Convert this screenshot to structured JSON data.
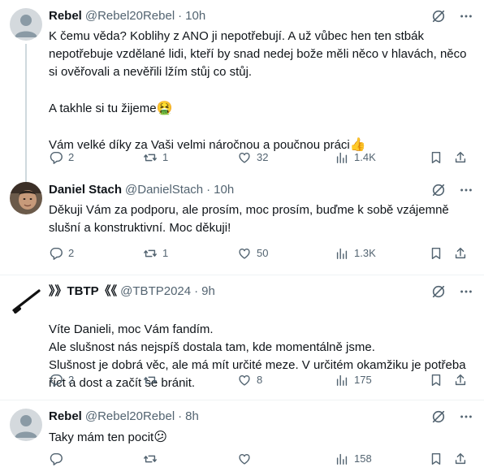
{
  "tweets": [
    {
      "name": "Rebel",
      "handle": "@Rebel20Rebel",
      "time": "10h",
      "paragraphs": [
        "K čemu věda? Koblihy z ANO ji nepotřebují. A už vůbec hen ten stbák nepotřebuje vzdělané lidi, kteří by snad nedej bože měli něco v hlavách, něco si ověřovali a nevěřili lžím stůj co stůj.",
        "A takhle si tu žijeme",
        "Vám velké díky za Vaši velmi náročnou a poučnou práci"
      ],
      "emojis": [
        "🤮",
        "👍"
      ],
      "replies": "2",
      "reposts": "1",
      "likes": "32",
      "views": "1.4K"
    },
    {
      "name": "Daniel Stach",
      "handle": "@DanielStach",
      "time": "10h",
      "paragraphs": [
        "Děkuji Vám za podporu, ale prosím, moc prosím, buďme k sobě vzájemně slušní a konstruktivní. Moc děkuji!"
      ],
      "replies": "2",
      "reposts": "1",
      "likes": "50",
      "views": "1.3K"
    },
    {
      "name": "》》TBTP《《",
      "handle": "@TBTP2024",
      "time": "9h",
      "paragraphs": [
        "Víte Danieli, moc Vám fandím.\nAle slušnost nás nejspíš dostala tam, kde momentálně jsme.\nSlušnost je dobrá věc, ale má mít určité meze. V určitém okamžiku je potřeba říct a dost a začít se bránit."
      ],
      "replies": "2",
      "reposts": "",
      "likes": "8",
      "views": "175"
    },
    {
      "name": "Rebel",
      "handle": "@Rebel20Rebel",
      "time": "8h",
      "paragraphs": [
        "Taky mám ten pocit"
      ],
      "emojis": [
        "😕"
      ],
      "replies": "",
      "reposts": "",
      "likes": "",
      "views": "158"
    }
  ],
  "separator": "·",
  "colors": {
    "text": "#0f1419",
    "secondary": "#536471",
    "thread_line": "#cfd9de",
    "divider": "#eff3f4",
    "grok_icon": "#536471"
  },
  "icons": [
    "default-avatar-icon",
    "grok-icon",
    "more-icon",
    "reply-icon",
    "repost-icon",
    "like-icon",
    "views-icon",
    "bookmark-icon",
    "share-icon"
  ]
}
